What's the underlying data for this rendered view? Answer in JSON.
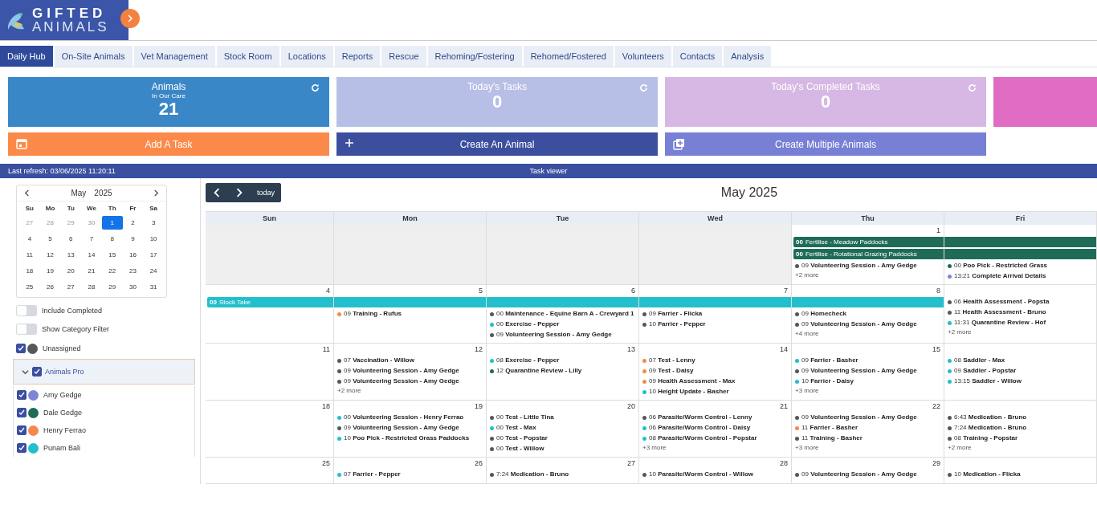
{
  "logo": {
    "line_1": "GIFTED",
    "line_2": "ANIMALS"
  },
  "tabs": [
    {
      "label": "Daily Hub",
      "selected": true
    },
    {
      "label": "On-Site Animals",
      "selected": false
    },
    {
      "label": "Vet Management",
      "selected": false
    },
    {
      "label": "Stock Room",
      "selected": false
    },
    {
      "label": "Locations",
      "selected": false
    },
    {
      "label": "Reports",
      "selected": false
    },
    {
      "label": "Rescue",
      "selected": false
    },
    {
      "label": "Rehoming/Fostering",
      "selected": false
    },
    {
      "label": "Rehomed/Fostered",
      "selected": false
    },
    {
      "label": "Volunteers",
      "selected": false
    },
    {
      "label": "Contacts",
      "selected": false
    },
    {
      "label": "Analysis",
      "selected": false
    }
  ],
  "stat_cards": [
    {
      "title": "Animals",
      "subtitle": "In Our Care",
      "value": "21",
      "color": "#3a87c8",
      "refresh": true
    },
    {
      "title": "Today's Tasks",
      "value": "0",
      "color": "#b8bfe6",
      "refresh": true
    },
    {
      "title": "Today's Completed Tasks",
      "value": "0",
      "color": "#d7b8e4",
      "refresh": true
    },
    {
      "color": "#e06cc3",
      "refresh": false
    }
  ],
  "action_buttons": [
    {
      "label": "Add A Task",
      "kind": "calendar",
      "color": "#fb8a4a"
    },
    {
      "label": "Create An Animal",
      "kind": "plus",
      "color": "#3c4f9e"
    },
    {
      "label": "Create Multiple Animals",
      "kind": "plus-stack",
      "color": "#7780d4"
    }
  ],
  "status_bar": {
    "last_refresh": "Last refresh: 03/06/2025 11:20:11",
    "title": "Task viewer"
  },
  "mini_calendar": {
    "month": "May",
    "year": "2025",
    "weekdays": [
      "Su",
      "Mo",
      "Tu",
      "We",
      "Th",
      "Fr",
      "Sa"
    ],
    "weeks": [
      [
        {
          "day": "27",
          "muted": true,
          "selected": false
        },
        {
          "day": "28",
          "muted": true,
          "selected": false
        },
        {
          "day": "29",
          "muted": true,
          "selected": false
        },
        {
          "day": "30",
          "muted": true,
          "selected": false
        },
        {
          "day": "1",
          "muted": false,
          "selected": true
        },
        {
          "day": "2",
          "muted": false,
          "selected": false
        },
        {
          "day": "3",
          "muted": false,
          "selected": false
        }
      ],
      [
        {
          "day": "4",
          "muted": false,
          "selected": false
        },
        {
          "day": "5",
          "muted": false,
          "selected": false
        },
        {
          "day": "6",
          "muted": false,
          "selected": false
        },
        {
          "day": "7",
          "muted": false,
          "selected": false
        },
        {
          "day": "8",
          "muted": false,
          "selected": false
        },
        {
          "day": "9",
          "muted": false,
          "selected": false
        },
        {
          "day": "10",
          "muted": false,
          "selected": false
        }
      ],
      [
        {
          "day": "11",
          "muted": false,
          "selected": false
        },
        {
          "day": "12",
          "muted": false,
          "selected": false
        },
        {
          "day": "13",
          "muted": false,
          "selected": false
        },
        {
          "day": "14",
          "muted": false,
          "selected": false
        },
        {
          "day": "15",
          "muted": false,
          "selected": false
        },
        {
          "day": "16",
          "muted": false,
          "selected": false
        },
        {
          "day": "17",
          "muted": false,
          "selected": false
        }
      ],
      [
        {
          "day": "18",
          "muted": false,
          "selected": false
        },
        {
          "day": "19",
          "muted": false,
          "selected": false
        },
        {
          "day": "20",
          "muted": false,
          "selected": false
        },
        {
          "day": "21",
          "muted": false,
          "selected": false
        },
        {
          "day": "22",
          "muted": false,
          "selected": false
        },
        {
          "day": "23",
          "muted": false,
          "selected": false
        },
        {
          "day": "24",
          "muted": false,
          "selected": false
        }
      ],
      [
        {
          "day": "25",
          "muted": false,
          "selected": false
        },
        {
          "day": "26",
          "muted": false,
          "selected": false
        },
        {
          "day": "27",
          "muted": false,
          "selected": false
        },
        {
          "day": "28",
          "muted": false,
          "selected": false
        },
        {
          "day": "29",
          "muted": false,
          "selected": false
        },
        {
          "day": "30",
          "muted": false,
          "selected": false
        },
        {
          "day": "31",
          "muted": false,
          "selected": false
        }
      ]
    ]
  },
  "toggles": [
    {
      "label": "Include Completed",
      "on": false
    },
    {
      "label": "Show Category Filter",
      "on": false
    }
  ],
  "assignees": [
    {
      "label": "Unassigned",
      "checked": true,
      "color": "#54585c"
    },
    {
      "label": "Animals Pro",
      "checked": true,
      "expanded": true,
      "children": [
        {
          "label": "Amy Gedge",
          "checked": true,
          "color": "#7b86d6"
        },
        {
          "label": "Dale Gedge",
          "checked": true,
          "color": "#1f6b57"
        },
        {
          "label": "Henry Ferrao",
          "checked": true,
          "color": "#f4894b"
        },
        {
          "label": "Punam Bali",
          "checked": true,
          "color": "#23bfcc"
        }
      ]
    }
  ],
  "calendar": {
    "title": "May 2025",
    "today_label": "today",
    "weekdays": [
      "Sun",
      "Mon",
      "Tue",
      "Wed",
      "Thu",
      "Fri"
    ],
    "weeks": [
      {
        "cells": [
          {
            "other_month": true
          },
          {
            "other_month": true
          },
          {
            "other_month": true
          },
          {
            "other_month": true
          },
          {
            "other_month": false,
            "date": "1",
            "bars": [
              {
                "time": "00",
                "title": "Fertilise - Meadow Paddocks",
                "color": "#1f6b57"
              },
              {
                "time": "00",
                "title": "Fertilise - Rotational Grazing Paddocks",
                "color": "#1f6b57"
              }
            ],
            "events": [
              {
                "time": "09",
                "title": "Volunteering Session - Amy Gedge",
                "color": "#54585c"
              }
            ],
            "more": "+2 more"
          },
          {
            "other_month": false,
            "bars": [
              {
                "color": "#1f6b57"
              },
              {
                "color": "#1f6b57"
              }
            ],
            "events": [
              {
                "time": "00",
                "title": "Poo Pick - Restricted Grass",
                "color": "#1f6b57"
              },
              {
                "time": "13:21",
                "title": "Complete Arrival Details",
                "color": "#7b86d6"
              }
            ]
          }
        ]
      },
      {
        "cells": [
          {
            "other_month": false,
            "date": "4",
            "bars": [
              {
                "time": "00",
                "title": "Stock Take",
                "color": "#23bfcc"
              }
            ]
          },
          {
            "other_month": false,
            "date": "5",
            "bars": [
              {
                "color": "#23bfcc"
              }
            ],
            "events": [
              {
                "time": "09",
                "title": "Training - Rufus",
                "color": "#f4894b"
              }
            ]
          },
          {
            "other_month": false,
            "date": "6",
            "bars": [
              {
                "color": "#23bfcc"
              }
            ],
            "events": [
              {
                "time": "00",
                "title": "Maintenance - Equine Barn A - Crewyard 1",
                "color": "#54585c"
              },
              {
                "time": "00",
                "title": "Exercise - Pepper",
                "color": "#23bfcc"
              },
              {
                "time": "09",
                "title": "Volunteering Session - Amy Gedge",
                "color": "#54585c"
              }
            ]
          },
          {
            "other_month": false,
            "date": "7",
            "bars": [
              {
                "color": "#23bfcc"
              }
            ],
            "events": [
              {
                "time": "09",
                "title": "Farrier - Flicka",
                "color": "#54585c"
              },
              {
                "time": "10",
                "title": "Farrier - Pepper",
                "color": "#54585c"
              }
            ]
          },
          {
            "other_month": false,
            "date": "8",
            "bars": [
              {
                "color": "#23bfcc"
              }
            ],
            "events": [
              {
                "time": "09",
                "title": "Homecheck",
                "color": "#54585c"
              },
              {
                "time": "09",
                "title": "Volunteering Session - Amy Gedge",
                "color": "#54585c"
              }
            ],
            "more": "+4 more"
          },
          {
            "other_month": false,
            "events": [
              {
                "time": "06",
                "title": "Health Assessment - Popsta",
                "color": "#54585c"
              },
              {
                "time": "11",
                "title": "Health Assessment - Bruno",
                "color": "#54585c"
              },
              {
                "time": "11:31",
                "title": "Quarantine Review - Hof",
                "color": "#23bfcc"
              }
            ],
            "more": "+2 more"
          }
        ]
      },
      {
        "cells": [
          {
            "other_month": false,
            "date": "11"
          },
          {
            "other_month": false,
            "date": "12",
            "events": [
              {
                "time": "07",
                "title": "Vaccination - Willow",
                "color": "#54585c"
              },
              {
                "time": "09",
                "title": "Volunteering Session - Amy Gedge",
                "color": "#54585c"
              },
              {
                "time": "09",
                "title": "Volunteering Session - Amy Gedge",
                "color": "#54585c"
              }
            ],
            "more": "+2 more"
          },
          {
            "other_month": false,
            "date": "13",
            "events": [
              {
                "time": "08",
                "title": "Exercise - Pepper",
                "color": "#23bfcc"
              },
              {
                "time": "12",
                "title": "Quarantine Review - Lilly",
                "color": "#1f6b57"
              }
            ]
          },
          {
            "other_month": false,
            "date": "14",
            "events": [
              {
                "time": "07",
                "title": "Test - Lenny",
                "color": "#f4894b"
              },
              {
                "time": "09",
                "title": "Test - Daisy",
                "color": "#f4894b"
              },
              {
                "time": "09",
                "title": "Health Assessment - Max",
                "color": "#f4894b"
              },
              {
                "time": "10",
                "title": "Height Update - Basher",
                "color": "#23bfcc"
              }
            ]
          },
          {
            "other_month": false,
            "date": "15",
            "events": [
              {
                "time": "09",
                "title": "Farrier - Basher",
                "color": "#23bfcc"
              },
              {
                "time": "09",
                "title": "Volunteering Session - Amy Gedge",
                "color": "#54585c"
              },
              {
                "time": "10",
                "title": "Farrier - Daisy",
                "color": "#23bfcc"
              }
            ],
            "more": "+3 more"
          },
          {
            "other_month": false,
            "events": [
              {
                "time": "08",
                "title": "Saddler - Max",
                "color": "#23bfcc"
              },
              {
                "time": "09",
                "title": "Saddler - Popstar",
                "color": "#23bfcc"
              },
              {
                "time": "13:15",
                "title": "Saddler - Willow",
                "color": "#23bfcc"
              }
            ]
          }
        ]
      },
      {
        "cells": [
          {
            "other_month": false,
            "date": "18"
          },
          {
            "other_month": false,
            "date": "19",
            "events": [
              {
                "time": "00",
                "title": "Volunteering Session - Henry Ferrao",
                "color": "#23bfcc"
              },
              {
                "time": "09",
                "title": "Volunteering Session - Amy Gedge",
                "color": "#54585c"
              },
              {
                "time": "10",
                "title": "Poo Pick - Restricted Grass Paddocks",
                "color": "#23bfcc"
              }
            ]
          },
          {
            "other_month": false,
            "date": "20",
            "events": [
              {
                "time": "00",
                "title": "Test - Little Tina",
                "color": "#54585c"
              },
              {
                "time": "00",
                "title": "Test - Max",
                "color": "#23bfcc"
              },
              {
                "time": "00",
                "title": "Test - Popstar",
                "color": "#54585c"
              },
              {
                "time": "00",
                "title": "Test - Willow",
                "color": "#54585c"
              }
            ]
          },
          {
            "other_month": false,
            "date": "21",
            "events": [
              {
                "time": "06",
                "title": "Parasite/Worm Control - Lenny",
                "color": "#54585c"
              },
              {
                "time": "06",
                "title": "Parasite/Worm Control - Daisy",
                "color": "#23bfcc"
              },
              {
                "time": "08",
                "title": "Parasite/Worm Control - Popstar",
                "color": "#23bfcc"
              }
            ],
            "more": "+3 more"
          },
          {
            "other_month": false,
            "date": "22",
            "events": [
              {
                "time": "09",
                "title": "Volunteering Session - Amy Gedge",
                "color": "#54585c"
              },
              {
                "time": "11",
                "title": "Farrier - Basher",
                "color": "#f4894b"
              },
              {
                "time": "11",
                "title": "Training - Basher",
                "color": "#54585c"
              }
            ],
            "more": "+3 more"
          },
          {
            "other_month": false,
            "events": [
              {
                "time": "6:43",
                "title": "Medication - Bruno",
                "color": "#54585c"
              },
              {
                "time": "7:24",
                "title": "Medication - Bruno",
                "color": "#54585c"
              },
              {
                "time": "08",
                "title": "Training - Popstar",
                "color": "#54585c"
              }
            ],
            "more": "+2 more"
          }
        ]
      },
      {
        "cells": [
          {
            "other_month": false,
            "date": "25"
          },
          {
            "other_month": false,
            "date": "26",
            "events": [
              {
                "time": "07",
                "title": "Farrier - Pepper",
                "color": "#23bfcc"
              }
            ]
          },
          {
            "other_month": false,
            "date": "27",
            "events": [
              {
                "time": "7:24",
                "title": "Medication - Bruno",
                "color": "#54585c"
              }
            ]
          },
          {
            "other_month": false,
            "date": "28",
            "events": [
              {
                "time": "10",
                "title": "Parasite/Worm Control - Willow",
                "color": "#54585c"
              }
            ]
          },
          {
            "other_month": false,
            "date": "29",
            "events": [
              {
                "time": "09",
                "title": "Volunteering Session - Amy Gedge",
                "color": "#54585c"
              }
            ]
          },
          {
            "other_month": false,
            "events": [
              {
                "time": "10",
                "title": "Medication - Flicka",
                "color": "#54585c"
              }
            ]
          }
        ]
      }
    ]
  }
}
